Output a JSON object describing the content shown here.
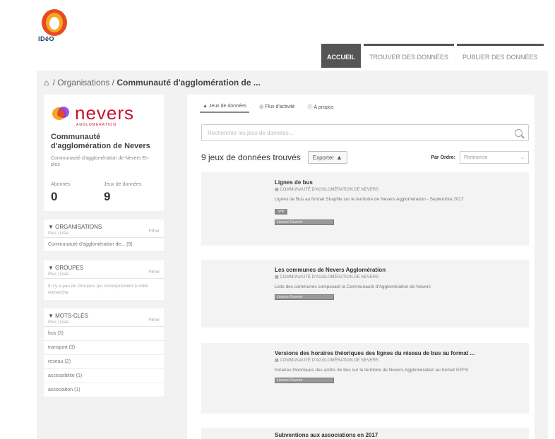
{
  "logo": {
    "text": "IDéO"
  },
  "topnav": {
    "items": [
      {
        "label": "ACCUEIL",
        "active": true
      },
      {
        "label": "TROUVER DES DONNÉES",
        "active": false
      },
      {
        "label": "PUBLIER DES DONNÉES",
        "active": false
      }
    ]
  },
  "breadcrumb": {
    "home_icon": "home-icon",
    "organisations": "Organisations",
    "separator": "/",
    "current": "Communauté d'agglomération de ..."
  },
  "org": {
    "logo_word": "nevers",
    "logo_sub": "AGGLOMÉRATION",
    "title": "Communauté d'agglomération de Nevers",
    "desc": "Communauté d'agglomération de Nevers En plus",
    "stats": [
      {
        "label": "Abonnés",
        "value": "0"
      },
      {
        "label": "Jeux de données",
        "value": "9"
      }
    ]
  },
  "facets": {
    "organisations": {
      "title": "ORGANISATIONS",
      "sub": "Plus | Liste",
      "filter": "Filtrer",
      "items": [
        "Communauté d'agglomération de... (9)"
      ]
    },
    "groupes": {
      "title": "GROUPES",
      "sub": "Plus | Liste",
      "filter": "Filtrer",
      "empty": "Il n'y a pas de Groupes qui correspondent à cette recherche"
    },
    "motscles": {
      "title": "MOTS-CLÉS",
      "sub": "Plus | Liste",
      "filter": "Filtrer",
      "items": [
        "bus (3)",
        "transport (3)",
        "reseau (2)",
        "accessibilite (1)",
        "association (1)"
      ]
    }
  },
  "main": {
    "tabs": [
      {
        "label": "Jeux de données",
        "icon": "sitemap-icon",
        "active": true
      },
      {
        "label": "Flux d'activité",
        "icon": "rss-icon",
        "active": false
      },
      {
        "label": "À propos",
        "icon": "info-icon",
        "active": false
      }
    ],
    "search_placeholder": "Rechercher les jeux de données...",
    "count": "9 jeux de données trouvés",
    "export_label": "Exporter",
    "sort_label": "Par Ordre:",
    "sort_value": "Pertinence"
  },
  "datasets": [
    {
      "title": "Lignes de bus",
      "org": "COMMUNAUTÉ D'AGGLOMÉRATION DE NEVERS",
      "desc": "Lignes de Bus au format Shapfile sur le territoire de Nevers Agglomération - Septembre 2017",
      "badge": "SHP",
      "tag": "Licence Ouverte"
    },
    {
      "title": "Les communes de Nevers Agglomération",
      "org": "COMMUNAUTÉ D'AGGLOMÉRATION DE NEVERS",
      "desc": "Liste des communes composant la Communauté d'Agglomération de Nevers",
      "badge": "",
      "tag": "Licence Ouverte"
    },
    {
      "title": "Versions des horaires théoriques des lignes du réseau de bus au format ...",
      "org": "COMMUNAUTÉ D'AGGLOMÉRATION DE NEVERS",
      "desc": "horaires théoriques des arrêts de bus sur le territoire de Nevers Agglomération au format GTFS",
      "badge": "",
      "tag": "Licence Ouverte"
    },
    {
      "title": "Subventions aux associations en 2017",
      "org": "",
      "desc": "",
      "badge": "",
      "tag": ""
    }
  ],
  "colors": {
    "accent": "#555555",
    "brand_red": "#c8102e",
    "logo_orange": "#f5a623"
  }
}
